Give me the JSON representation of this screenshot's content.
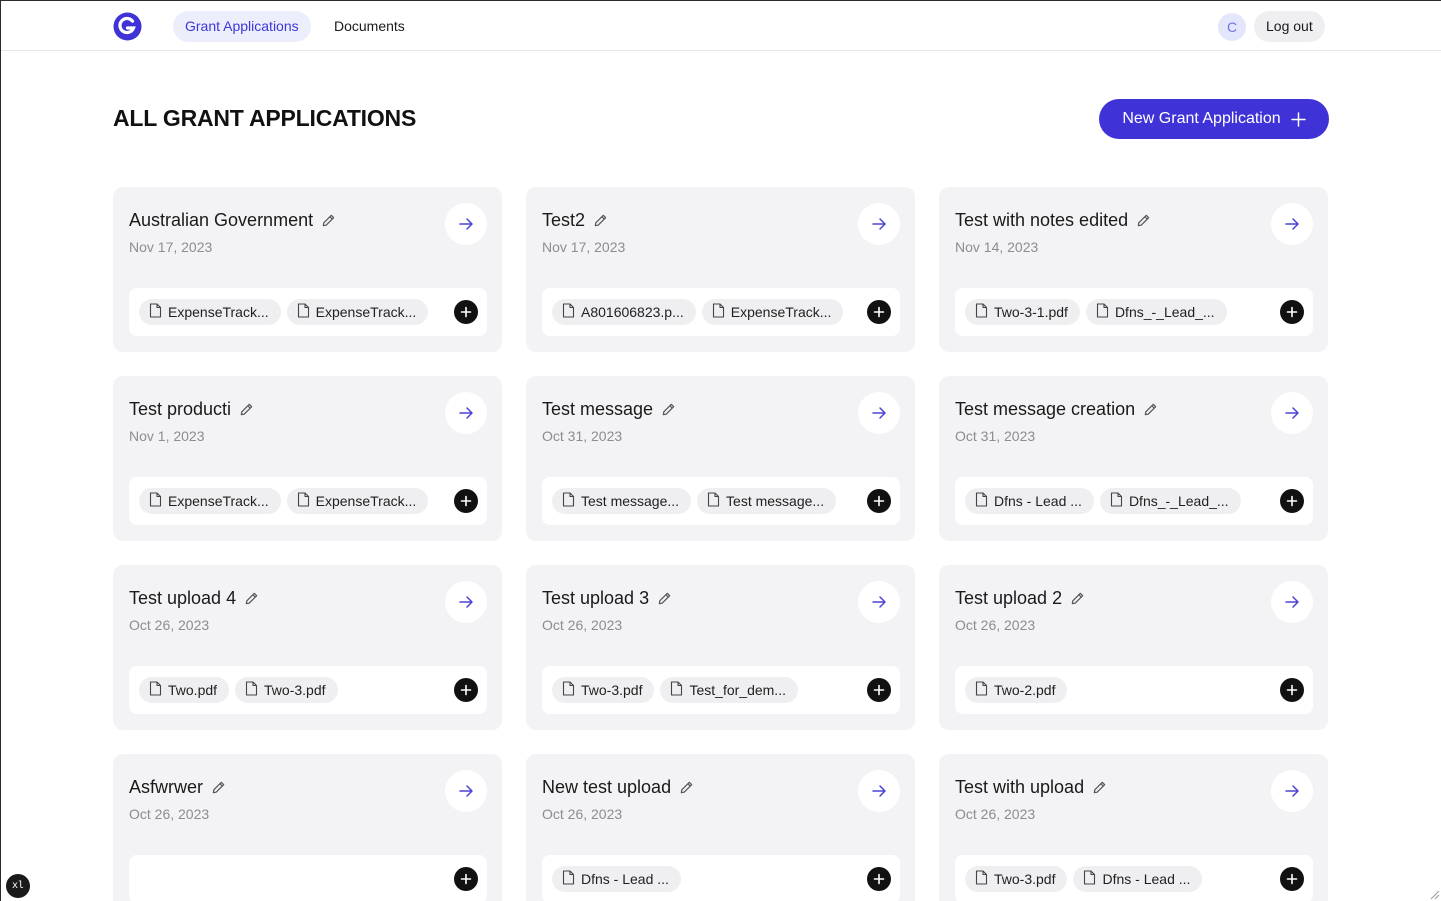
{
  "nav": {
    "tabs": [
      {
        "label": "Grant Applications",
        "active": true
      },
      {
        "label": "Documents",
        "active": false
      }
    ],
    "avatar_initial": "C",
    "logout_label": "Log out"
  },
  "page": {
    "title": "ALL GRANT APPLICATIONS",
    "new_button_label": "New Grant Application"
  },
  "colors": {
    "accent": "#3f33d8",
    "active_tab_bg": "#eceefc",
    "card_bg": "#f3f3f5"
  },
  "icons": {
    "edit": "pencil-icon",
    "open": "arrow-right-icon",
    "file": "file-icon",
    "add": "plus-icon"
  },
  "applications": [
    {
      "title": "Australian Government",
      "date": "Nov 17, 2023",
      "files": [
        "ExpenseTrack...",
        "ExpenseTrack..."
      ]
    },
    {
      "title": "Test2",
      "date": "Nov 17, 2023",
      "files": [
        "A801606823.p...",
        "ExpenseTrack..."
      ]
    },
    {
      "title": "Test with notes edited",
      "date": "Nov 14, 2023",
      "files": [
        "Two-3-1.pdf",
        "Dfns_-_Lead_..."
      ]
    },
    {
      "title": "Test producti",
      "date": "Nov 1, 2023",
      "files": [
        "ExpenseTrack...",
        "ExpenseTrack..."
      ]
    },
    {
      "title": "Test message",
      "date": "Oct 31, 2023",
      "files": [
        "Test message...",
        "Test message..."
      ]
    },
    {
      "title": "Test message creation",
      "date": "Oct 31, 2023",
      "files": [
        "Dfns - Lead ...",
        "Dfns_-_Lead_..."
      ]
    },
    {
      "title": "Test upload 4",
      "date": "Oct 26, 2023",
      "files": [
        "Two.pdf",
        "Two-3.pdf"
      ]
    },
    {
      "title": "Test upload 3",
      "date": "Oct 26, 2023",
      "files": [
        "Two-3.pdf",
        "Test_for_dem..."
      ]
    },
    {
      "title": "Test upload 2",
      "date": "Oct 26, 2023",
      "files": [
        "Two-2.pdf"
      ]
    },
    {
      "title": "Asfwrwer",
      "date": "Oct 26, 2023",
      "files": []
    },
    {
      "title": "New test upload",
      "date": "Oct 26, 2023",
      "files": [
        "Dfns - Lead ..."
      ]
    },
    {
      "title": "Test with upload",
      "date": "Oct 26, 2023",
      "files": [
        "Two-3.pdf",
        "Dfns - Lead ..."
      ]
    }
  ],
  "corner_badge": "xl"
}
